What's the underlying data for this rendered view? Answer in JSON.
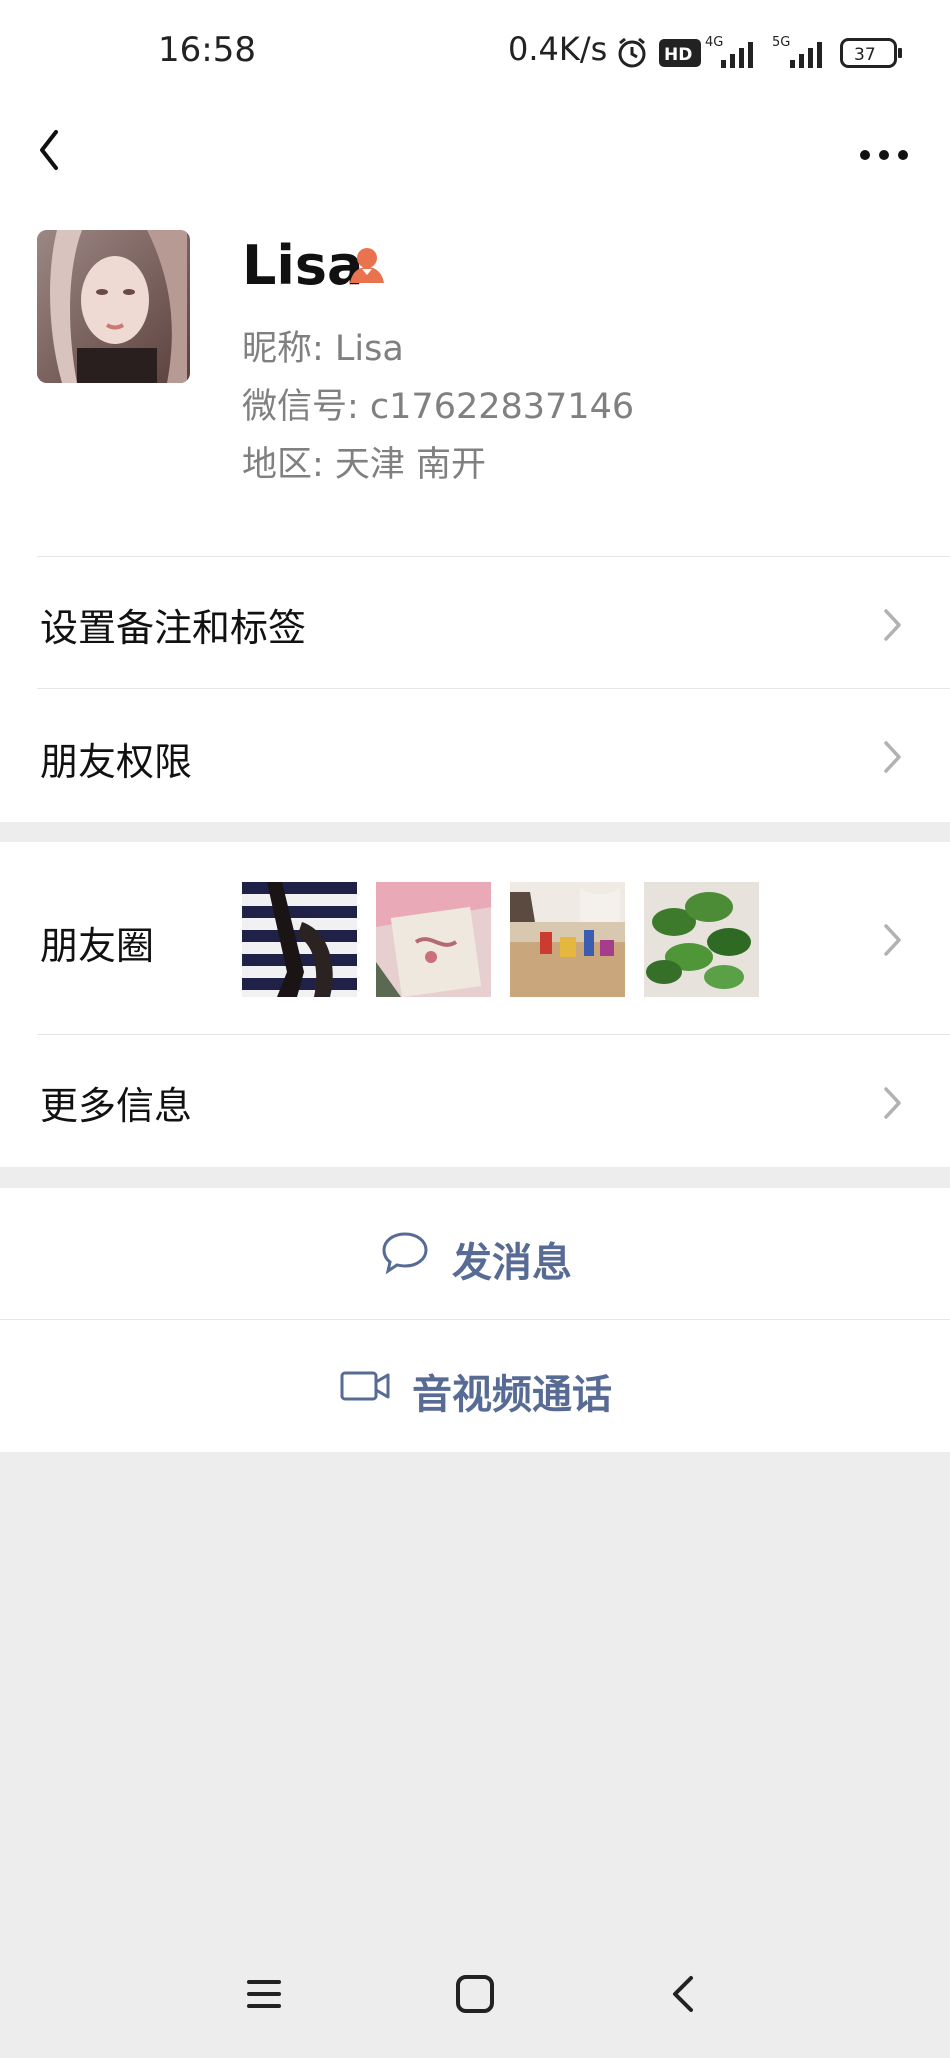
{
  "status_bar": {
    "time": "16:58",
    "net_speed": "0.4K/s",
    "battery": "37",
    "icons": [
      "alarm-icon",
      "hd-icon",
      "4g-signal-icon",
      "5g-signal-icon",
      "battery-icon"
    ]
  },
  "nav": {
    "back_icon": "back-icon",
    "more_icon": "more-icon"
  },
  "profile": {
    "name": "Lisa",
    "nickname": "昵称:  Lisa",
    "wechat_id": "微信号:  c17622837146",
    "region": "地区:  天津  南开",
    "gender_badge": "female-user-icon"
  },
  "menu": {
    "remark_tags": "设置备注和标签",
    "friend_permissions": "朋友权限",
    "moments": "朋友圈",
    "more_info": "更多信息"
  },
  "actions": {
    "send_message": "发消息",
    "video_call": "音视频通话"
  },
  "colors": {
    "accent": "#576b95",
    "badge": "#e9734f",
    "background": "#ededed"
  }
}
